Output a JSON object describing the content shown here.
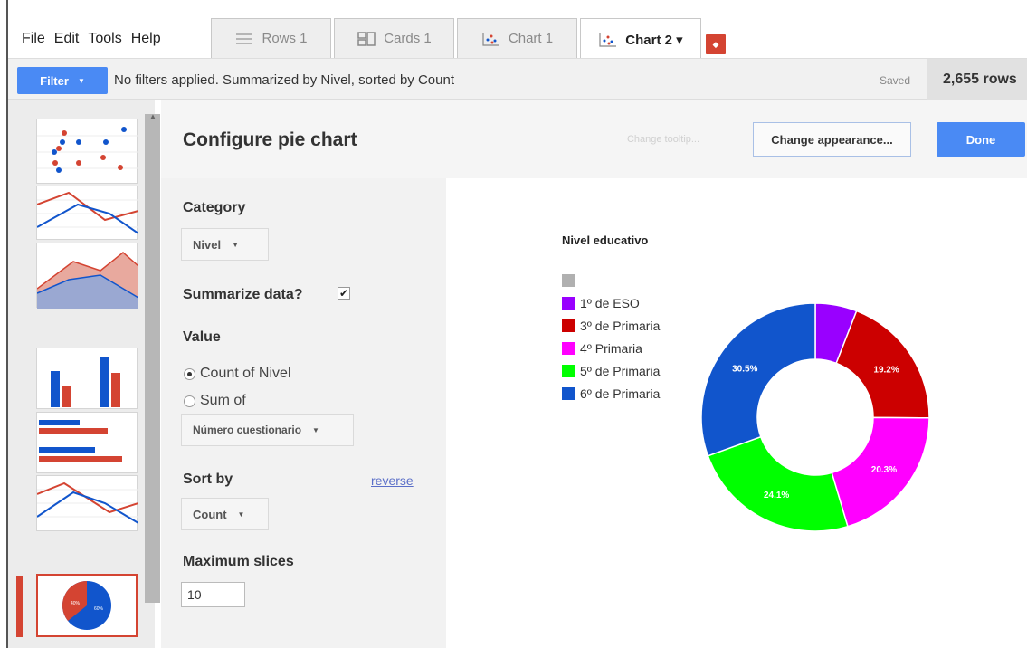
{
  "menu": [
    "File",
    "Edit",
    "Tools",
    "Help"
  ],
  "tabs": [
    {
      "label": "Rows 1",
      "icon": "rows-icon",
      "active": false
    },
    {
      "label": "Cards 1",
      "icon": "cards-icon",
      "active": false
    },
    {
      "label": "Chart 1",
      "icon": "chart-icon",
      "active": false
    },
    {
      "label": "Chart 2 ▾",
      "icon": "chart-icon",
      "active": true
    }
  ],
  "filterbar": {
    "filter_label": "Filter",
    "summary": "No filters applied. Summarized by Nivel, sorted by Count",
    "saved": "Saved",
    "rows": "2,655 rows"
  },
  "config": {
    "title": "Configure pie chart",
    "tooltip_button": "Change tooltip...",
    "appearance_button": "Change appearance...",
    "done_button": "Done",
    "category_label": "Category",
    "category_value": "Nivel",
    "summarize_label": "Summarize data?",
    "summarize_checked": true,
    "value_label": "Value",
    "value_option_count": "Count of Nivel",
    "value_option_sum": "Sum of",
    "sum_field": "Número cuestionario",
    "sort_label": "Sort by",
    "reverse_link": "reverse",
    "sort_value": "Count",
    "max_slices_label": "Maximum slices",
    "max_slices_value": "10"
  },
  "colors": {
    "accent": "#4a8af4",
    "tab_add": "#d44432"
  },
  "chart_data": {
    "type": "pie",
    "title": "Nivel educativo",
    "donut": true,
    "slices": [
      {
        "label": "",
        "color": "#b0b0b0",
        "percent": 0
      },
      {
        "label": "1º de ESO",
        "color": "#9900ff",
        "percent": 5.9
      },
      {
        "label": "3º de Primaria",
        "color": "#cc0000",
        "percent": 19.2
      },
      {
        "label": "4º Primaria",
        "color": "#ff00ff",
        "percent": 20.3
      },
      {
        "label": "5º de Primaria",
        "color": "#00ff00",
        "percent": 24.1
      },
      {
        "label": "6º de Primaria",
        "color": "#1155cc",
        "percent": 30.5
      }
    ],
    "data_labels": [
      "19.2%",
      "20.3%",
      "24.1%",
      "30.5%"
    ]
  }
}
